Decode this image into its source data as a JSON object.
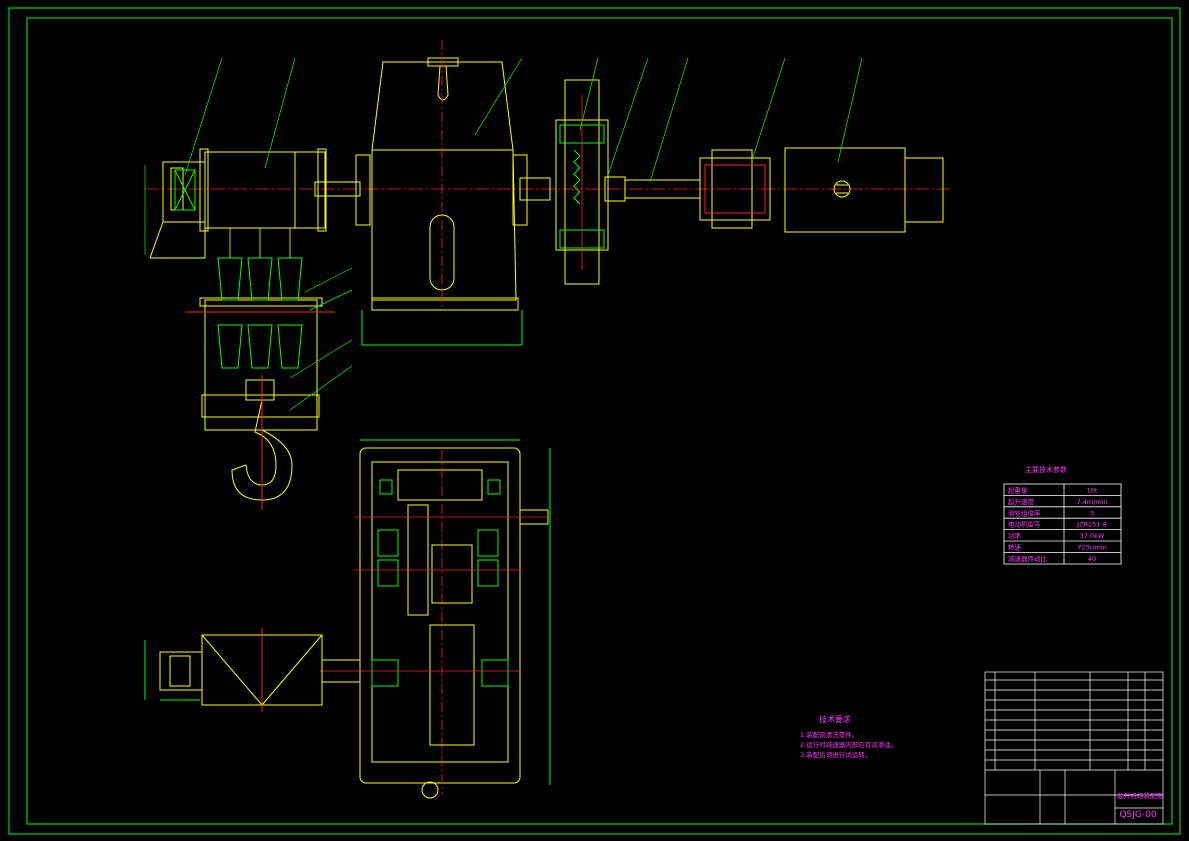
{
  "colors": {
    "background": "#000000",
    "border": "#00ff00",
    "outline": "#ffff00",
    "section": "#00ff00",
    "centerline": "#ff2020",
    "dimension": "#00ff00",
    "text": "#ff33ff",
    "table_line": "#ffffff"
  },
  "params_table": {
    "title": "主要技术参数",
    "rows": [
      {
        "label": "起重量",
        "value": "10t"
      },
      {
        "label": "起升速度",
        "value": "7.4m/min"
      },
      {
        "label": "滑轮组倍率",
        "value": "3"
      },
      {
        "label": "电动机型号",
        "value": "JZR251-8"
      },
      {
        "label": "功率",
        "value": "37.0kW"
      },
      {
        "label": "转速",
        "value": "723r/min"
      },
      {
        "label": "减速器传动比",
        "value": "40"
      }
    ]
  },
  "tech_requirements": {
    "title": "技术要求",
    "items": [
      "1.装配前清洗零件。",
      "2.运行时减速器内部应有润滑油。",
      "3.装配后须进行试运转。"
    ]
  },
  "title_block": {
    "drawing_name": "起升机构装配图",
    "drawing_number": "QSJG-00"
  }
}
